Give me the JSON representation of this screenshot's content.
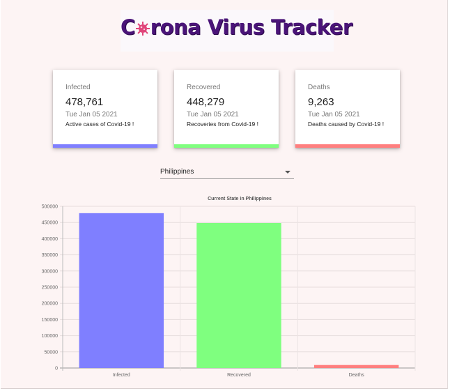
{
  "header": {
    "title": "Corona Virus Tracker",
    "title_before_icon": "C",
    "title_after_icon": "rona Virus Tracker"
  },
  "cards": [
    {
      "label": "Infected",
      "value": "478,761",
      "date": "Tue Jan 05 2021",
      "description": "Active cases of Covid-19 !",
      "color": "#7f7fff"
    },
    {
      "label": "Recovered",
      "value": "448,279",
      "date": "Tue Jan 05 2021",
      "description": "Recoveries from Covid-19 !",
      "color": "#7fff7f"
    },
    {
      "label": "Deaths",
      "value": "9,263",
      "date": "Tue Jan 05 2021",
      "description": "Deaths caused by Covid-19 !",
      "color": "#ff7f7f"
    }
  ],
  "country_select": {
    "selected": "Philippines"
  },
  "chart_data": {
    "type": "bar",
    "title": "Current State in Philippines",
    "categories": [
      "Infected",
      "Recovered",
      "Deaths"
    ],
    "values": [
      478761,
      448279,
      9263
    ],
    "colors": [
      "#7f7fff",
      "#7fff7f",
      "#ff7f7f"
    ],
    "ylim": [
      0,
      500000
    ],
    "yticks": [
      0,
      50000,
      100000,
      150000,
      200000,
      250000,
      300000,
      350000,
      400000,
      450000,
      500000
    ],
    "ytick_labels": [
      "0",
      "50000",
      "100000",
      "150000",
      "200000",
      "250000",
      "300000",
      "350000",
      "400000",
      "450000",
      "500000"
    ],
    "grid": true,
    "legend": "none"
  }
}
